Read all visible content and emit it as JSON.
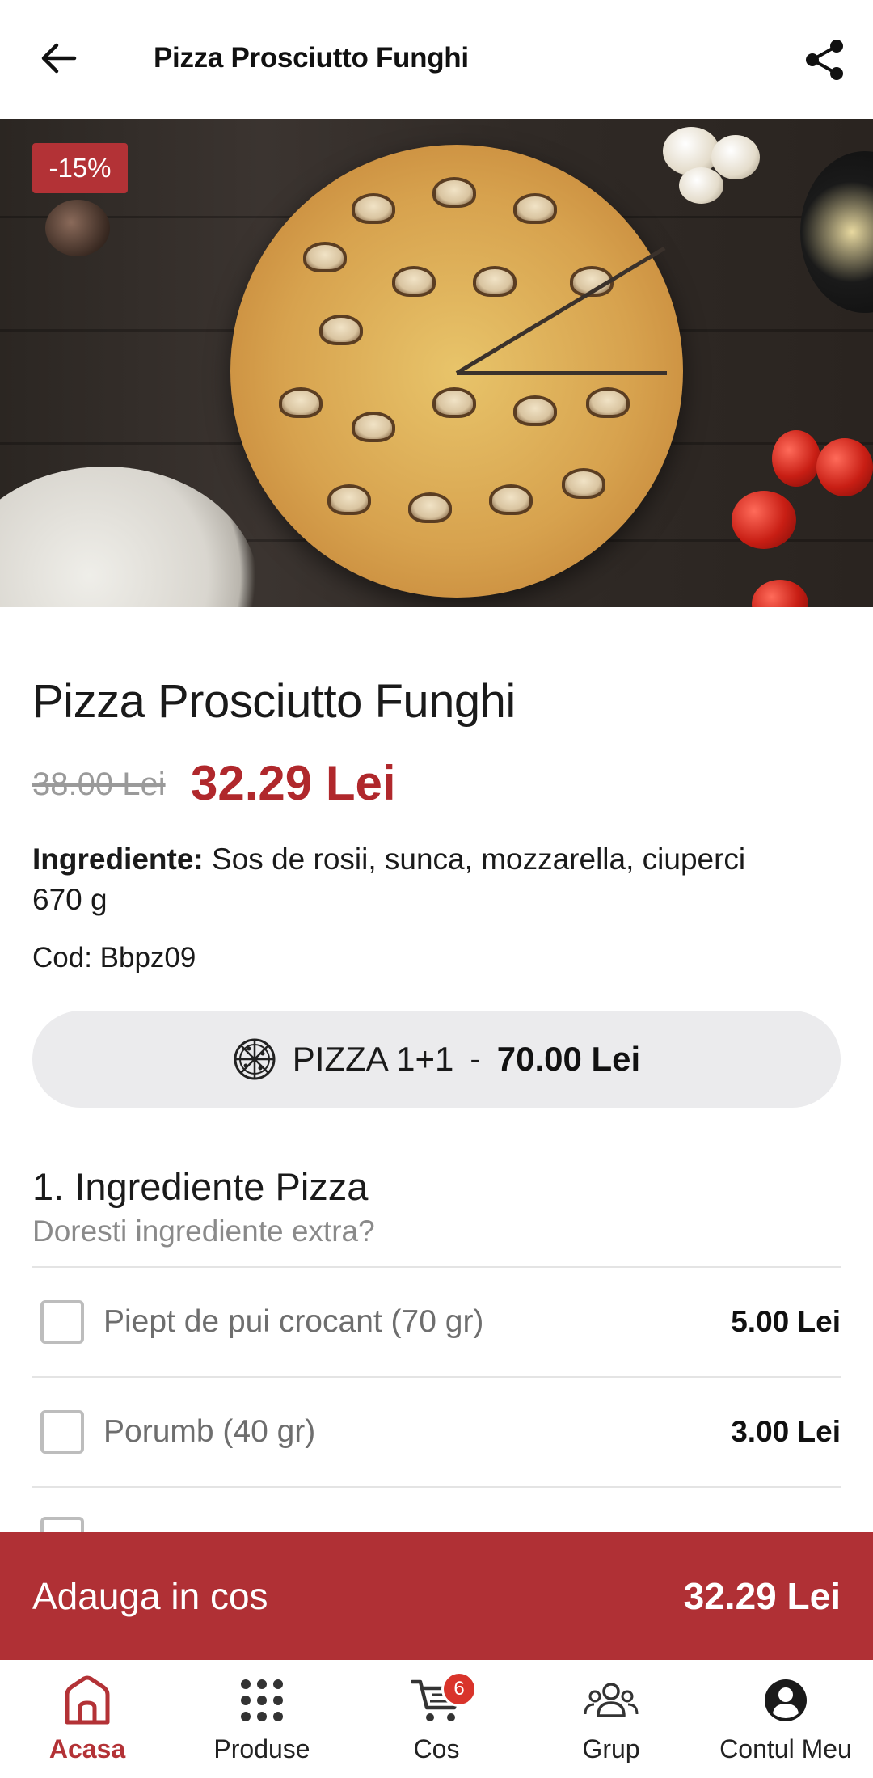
{
  "header": {
    "title": "Pizza Prosciutto Funghi"
  },
  "hero": {
    "discount_badge": "-15%"
  },
  "product": {
    "name": "Pizza Prosciutto Funghi",
    "old_price": "38.00 Lei",
    "price": "32.29 Lei",
    "ingredients_label": "Ingrediente:",
    "ingredients": "Sos de rosii, sunca, mozzarella, ciuperci",
    "weight": "670 g",
    "code": "Cod: Bbpz09"
  },
  "offer": {
    "name": "PIZZA 1+1",
    "separator": "-",
    "price": "70.00 Lei"
  },
  "extras": {
    "title": "1. Ingrediente Pizza",
    "subtitle": "Doresti ingrediente extra?",
    "options": [
      {
        "label": "Piept de pui crocant (70 gr)",
        "price": "5.00 Lei",
        "checked": false
      },
      {
        "label": "Porumb (40 gr)",
        "price": "3.00 Lei",
        "checked": false
      }
    ]
  },
  "cart": {
    "label": "Adauga in cos",
    "total": "32.29 Lei"
  },
  "nav": {
    "items": [
      {
        "label": "Acasa",
        "icon": "home-icon",
        "active": true
      },
      {
        "label": "Produse",
        "icon": "grid-icon",
        "active": false
      },
      {
        "label": "Cos",
        "icon": "cart-icon",
        "active": false,
        "badge": "6"
      },
      {
        "label": "Grup",
        "icon": "group-icon",
        "active": false
      },
      {
        "label": "Contul Meu",
        "icon": "account-icon",
        "active": false
      }
    ]
  },
  "colors": {
    "accent": "#b33236",
    "cart_bar": "#b03035",
    "price": "#b0282c"
  }
}
